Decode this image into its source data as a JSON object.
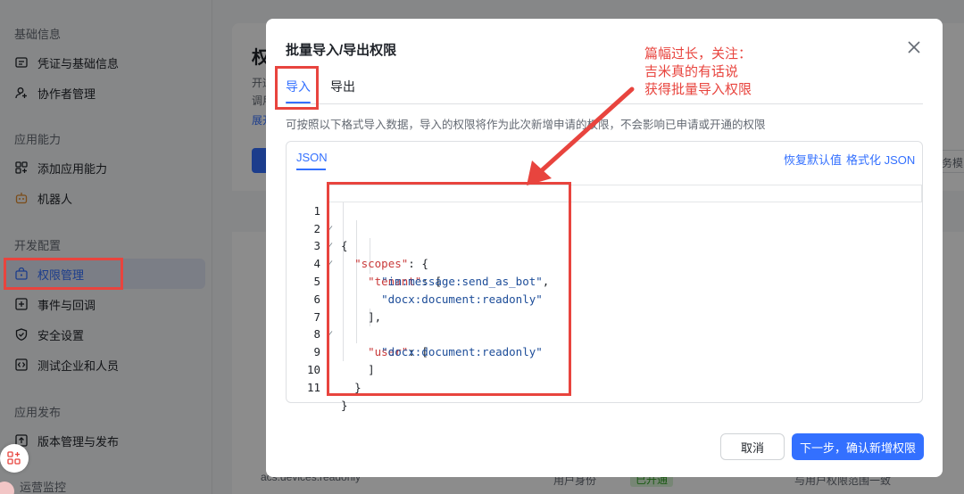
{
  "sidebar": {
    "groups": [
      {
        "title": "基础信息",
        "items": [
          "凭证与基础信息",
          "协作者管理"
        ]
      },
      {
        "title": "应用能力",
        "items": [
          "添加应用能力",
          "机器人"
        ]
      },
      {
        "title": "开发配置",
        "items": [
          "权限管理",
          "事件与回调",
          "安全设置",
          "测试企业和人员"
        ]
      },
      {
        "title": "应用发布",
        "items": [
          "版本管理与发布"
        ]
      },
      {
        "title": "运营监控",
        "items": []
      }
    ]
  },
  "background": {
    "page_title": "权限管理",
    "line1": "开通",
    "line2": "调用",
    "link": "展开",
    "partial_right": "务模",
    "row_scope": "acs:devices:readonly",
    "row_identity": "用户身份",
    "row_status": "已开通",
    "row_range": "与用户权限范围一致"
  },
  "modal": {
    "title": "批量导入/导出权限",
    "tabs": [
      "导入",
      "导出"
    ],
    "hint": "可按照以下格式导入数据，导入的权限将作为此次新增申请的权限，不会影响已申请或开通的权限",
    "editor": {
      "tab_label": "JSON",
      "restore_default": "恢复默认值",
      "format_json": "格式化 JSON"
    },
    "cancel_label": "取消",
    "next_label": "下一步，确认新增权限"
  },
  "code": {
    "line_numbers": [
      "1",
      "2",
      "3",
      "4",
      "5",
      "6",
      "7",
      "8",
      "9",
      "10",
      "11"
    ],
    "brace_open": "{",
    "scopes_key": "\"scopes\"",
    "tenant_key": "\"tenant\"",
    "tenant_val1": "\"im:message:send_as_bot\"",
    "tenant_val2": "\"docx:document:readonly\"",
    "user_key": "\"user\"",
    "user_val1": "\"docx:document:readonly\"",
    "colon_brace": ": {",
    "colon_bracket": ": [",
    "comma": ",",
    "bracket_close_comma": "],",
    "bracket_close": "]",
    "brace_close": "}"
  },
  "annotation": {
    "lines": [
      "篇幅过长，关注：",
      "吉米真的有话说",
      "获得批量导入权限"
    ],
    "color": "#e8443e"
  },
  "colors": {
    "accent": "#3370ff",
    "overlay": "rgba(0,0,0,0.45)"
  }
}
